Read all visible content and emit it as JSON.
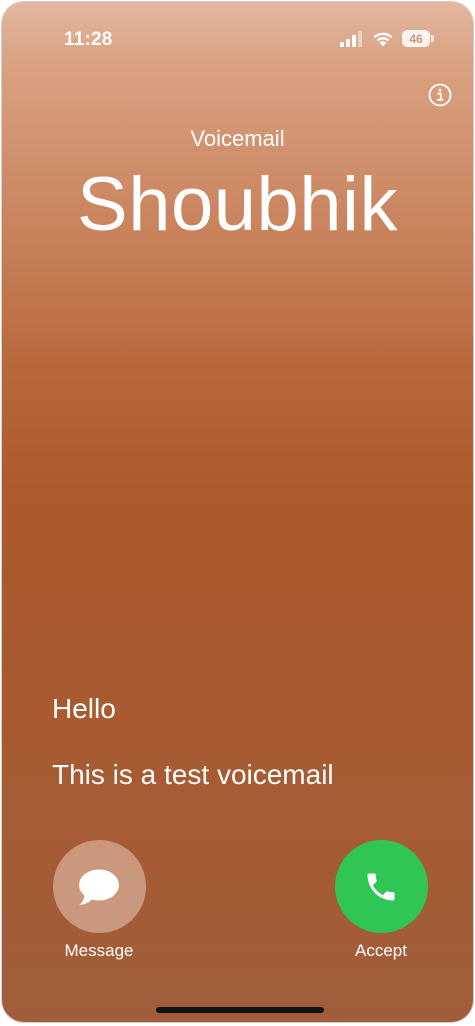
{
  "status_bar": {
    "time": "11:28",
    "battery": "46",
    "icons": [
      "signal-icon",
      "wifi-icon",
      "battery-icon"
    ]
  },
  "header": {
    "subtitle": "Voicemail",
    "caller": "Shoubhik",
    "info_icon": "info-icon"
  },
  "transcript": {
    "lines": [
      "Hello",
      "This is a test voicemail"
    ]
  },
  "actions": {
    "message": {
      "label": "Message",
      "icon": "message-bubble-icon"
    },
    "accept": {
      "label": "Accept",
      "icon": "phone-icon",
      "color": "#31c653"
    }
  }
}
